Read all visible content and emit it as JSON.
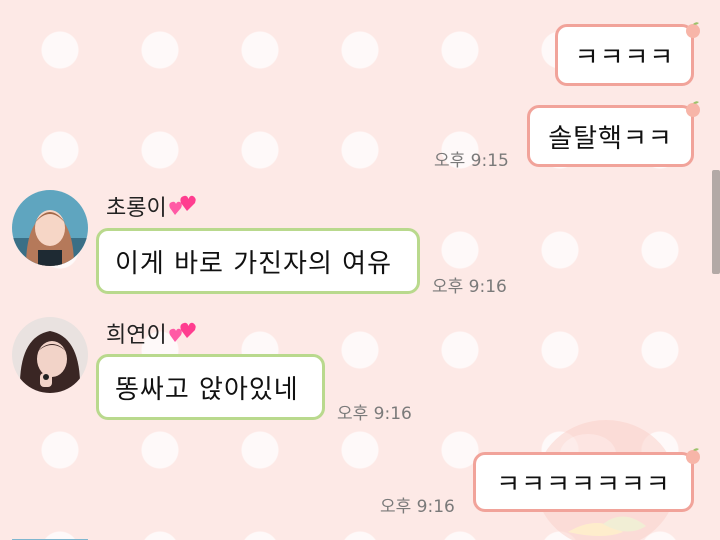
{
  "colors": {
    "background": "#fde9e6",
    "my_bubble_border": "#f1a39a",
    "their_bubble_border": "#b9d98d",
    "timestamp": "#7a7a7a"
  },
  "messages": [
    {
      "side": "me",
      "text": "ㅋㅋㅋㅋ",
      "time": ""
    },
    {
      "side": "me",
      "text": "솔탈핵ㅋㅋ",
      "time": "오후 9:15"
    },
    {
      "side": "them",
      "sender": "초롱이",
      "text": "이게 바로 가진자의 여유",
      "time": "오후 9:16"
    },
    {
      "side": "them",
      "sender": "희연이",
      "text": "똥싸고 앉아있네",
      "time": "오후 9:16"
    },
    {
      "side": "me",
      "text": "ㅋㅋㅋㅋㅋㅋㅋ",
      "time": "오후 9:16"
    }
  ],
  "icons": {
    "bubble_tag": "peach-icon",
    "sender_badge": "two-hearts-icon"
  }
}
